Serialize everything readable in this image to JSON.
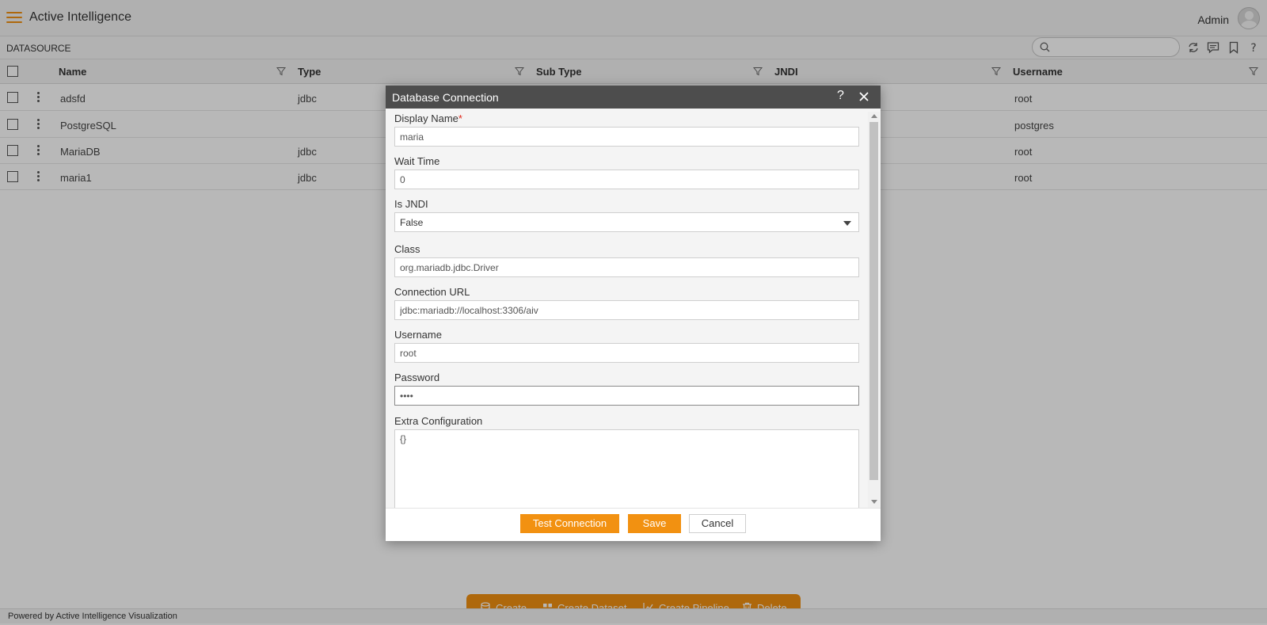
{
  "app": {
    "title": "Active Intelligence",
    "user": "Admin"
  },
  "page": {
    "label": "DATASOURCE"
  },
  "search": {
    "placeholder": ""
  },
  "toolbar_icons": [
    "refresh-icon",
    "comment-icon",
    "bookmark-icon",
    "help-icon"
  ],
  "grid": {
    "columns": [
      "Name",
      "Type",
      "Sub Type",
      "JNDI",
      "Username"
    ],
    "rows": [
      {
        "name": "adsfd",
        "type": "jdbc",
        "sub_type": "",
        "jndi": "",
        "username": "root"
      },
      {
        "name": "PostgreSQL",
        "type": "",
        "sub_type": "",
        "jndi": "",
        "username": "postgres"
      },
      {
        "name": "MariaDB",
        "type": "jdbc",
        "sub_type": "",
        "jndi": "",
        "username": "root"
      },
      {
        "name": "maria1",
        "type": "jdbc",
        "sub_type": "",
        "jndi": "",
        "username": "root"
      }
    ]
  },
  "modal": {
    "title": "Database Connection",
    "help": "?",
    "fields": {
      "display_name": {
        "label": "Display Name",
        "required_mark": "*",
        "value": "maria"
      },
      "wait_time": {
        "label": "Wait Time",
        "value": "0"
      },
      "is_jndi": {
        "label": "Is JNDI",
        "value": "False"
      },
      "class": {
        "label": "Class",
        "value": "org.mariadb.jdbc.Driver"
      },
      "connection_url": {
        "label": "Connection URL",
        "value": "jdbc:mariadb://localhost:3306/aiv"
      },
      "username": {
        "label": "Username",
        "value": "root"
      },
      "password": {
        "label": "Password",
        "value": "••••"
      },
      "extra_configuration": {
        "label": "Extra Configuration",
        "value": "{}"
      }
    },
    "buttons": {
      "test": "Test Connection",
      "save": "Save",
      "cancel": "Cancel"
    }
  },
  "actions": {
    "create": "Create",
    "create_dataset": "Create Dataset",
    "create_pipeline": "Create Pipeline",
    "delete": "Delete"
  },
  "footer": {
    "text": "Powered by  Active Intelligence Visualization"
  },
  "colors": {
    "accent": "#f29111",
    "modal_header": "#4d4d4d",
    "required": "#e0281b"
  }
}
